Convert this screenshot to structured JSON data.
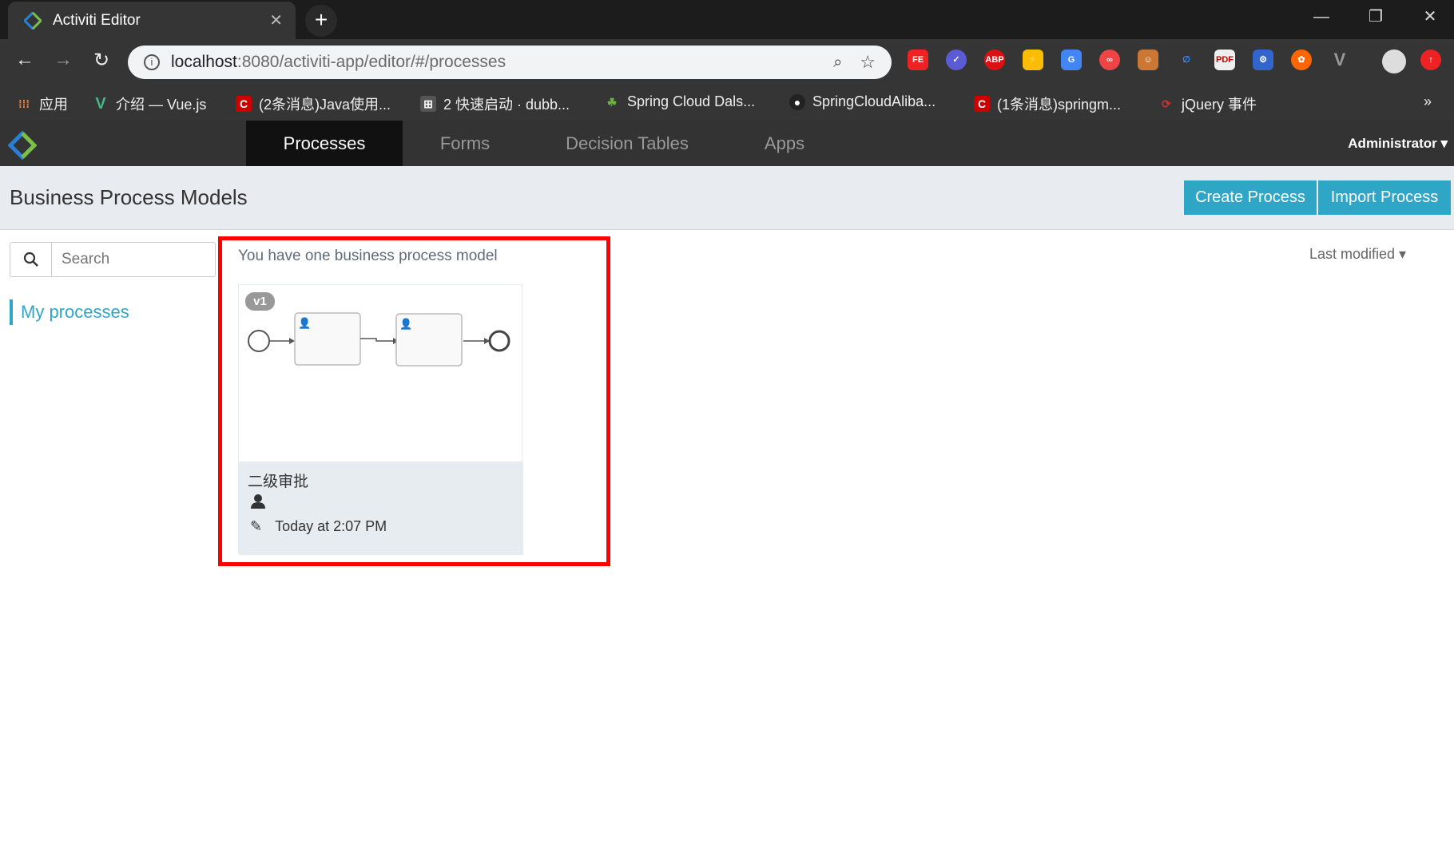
{
  "browser": {
    "tab_title": "Activiti Editor",
    "url_host": "localhost",
    "url_path": ":8080/activiti-app/editor/#/processes",
    "bookmarks": [
      {
        "label": "应用",
        "color": "#e84"
      },
      {
        "label": "介绍 — Vue.js",
        "color": "#41b883"
      },
      {
        "label": "(2条消息)Java使用...",
        "color": "#c00"
      },
      {
        "label": "2 快速启动 · dubb...",
        "color": "#555"
      },
      {
        "label": "Spring Cloud Dals...",
        "color": "#6db33f"
      },
      {
        "label": "SpringCloudAliba...",
        "color": "#222"
      },
      {
        "label": "(1条消息)springm...",
        "color": "#c00"
      },
      {
        "label": "jQuery 事件",
        "color": "#c33"
      }
    ],
    "more": "»"
  },
  "app": {
    "nav": [
      {
        "label": "Processes",
        "active": true
      },
      {
        "label": "Forms"
      },
      {
        "label": "Decision Tables"
      },
      {
        "label": "Apps"
      }
    ],
    "user": "Administrator ▾",
    "brand_color": "#2fa6c5"
  },
  "header": {
    "title": "Business Process Models",
    "create": "Create Process",
    "import": "Import Process"
  },
  "sidebar": {
    "search_placeholder": "Search",
    "filter": "My processes"
  },
  "main": {
    "count_text": "You have one business process model",
    "sort": "Last modified ▾",
    "models": [
      {
        "version": "v1",
        "name": "二级审批",
        "modified": "Today at 2:07 PM"
      }
    ]
  }
}
